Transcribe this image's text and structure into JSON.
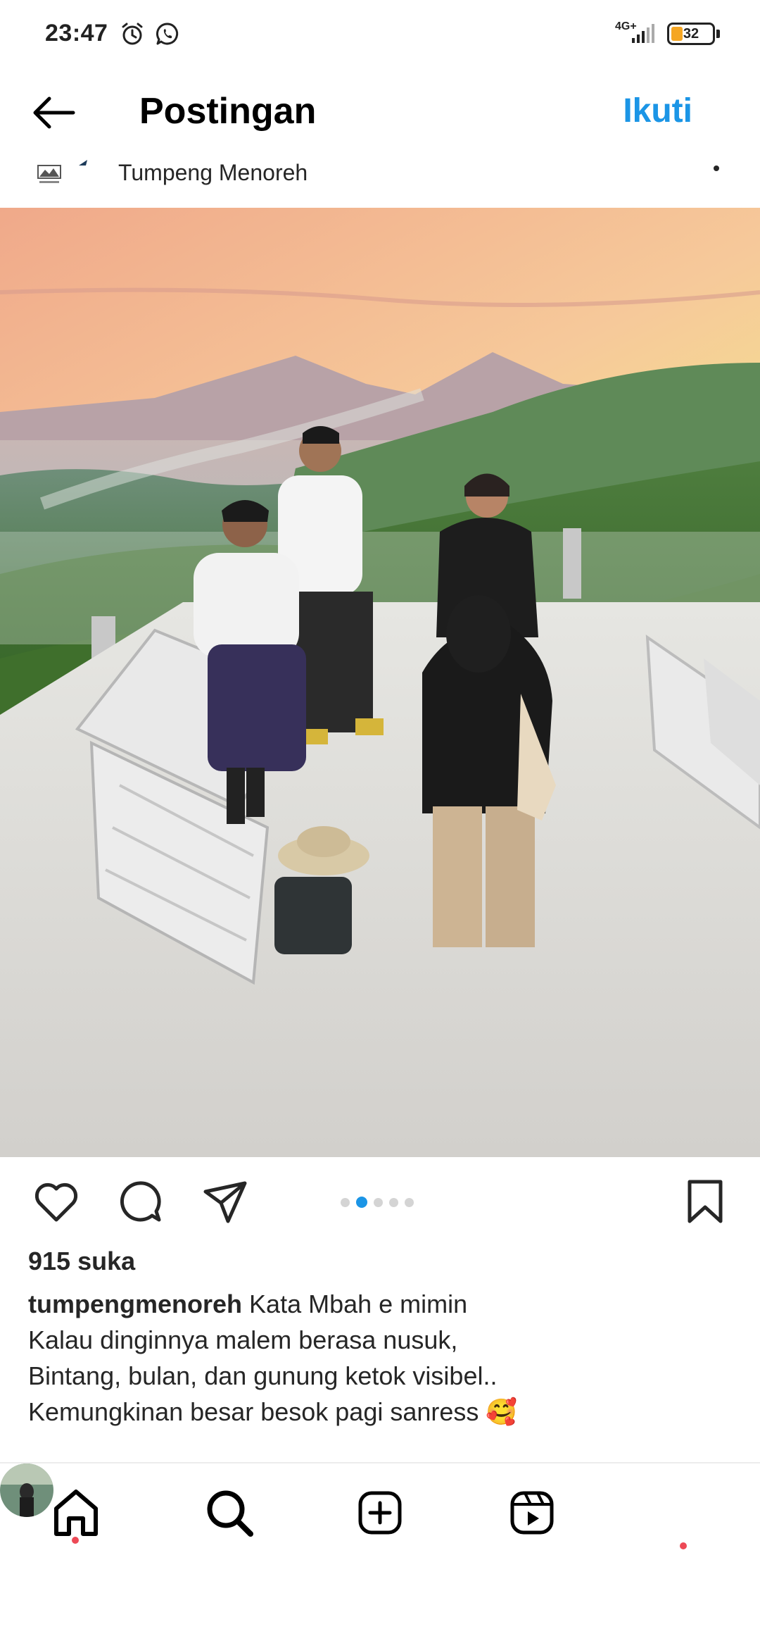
{
  "status_bar": {
    "time": "23:47",
    "network": "4G+",
    "battery": "32",
    "icons": [
      "alarm-icon",
      "whatsapp-icon",
      "signal-icon",
      "battery-icon"
    ]
  },
  "header": {
    "title": "Postingan",
    "follow_label": "Ikuti"
  },
  "account": {
    "name": "Tumpeng Menoreh"
  },
  "carousel": {
    "count": 5,
    "active_index": 1
  },
  "actions": [
    "heart-icon",
    "comment-icon",
    "share-icon",
    "bookmark-icon"
  ],
  "likes": "915 suka",
  "caption": {
    "username": "tumpengmenoreh",
    "first_line": "Kata Mbah e mimin",
    "lines": [
      "Kalau dinginnya malem berasa nusuk,",
      "Bintang, bulan, dan gunung ketok visibel..",
      "Kemungkinan besar besok pagi sanress 🥰"
    ]
  },
  "bottom_nav": [
    "home-icon",
    "search-icon",
    "create-icon",
    "reels-icon",
    "profile-avatar"
  ],
  "colors": {
    "accent": "#1b95e6",
    "notification": "#ed4956",
    "text": "#262626"
  }
}
